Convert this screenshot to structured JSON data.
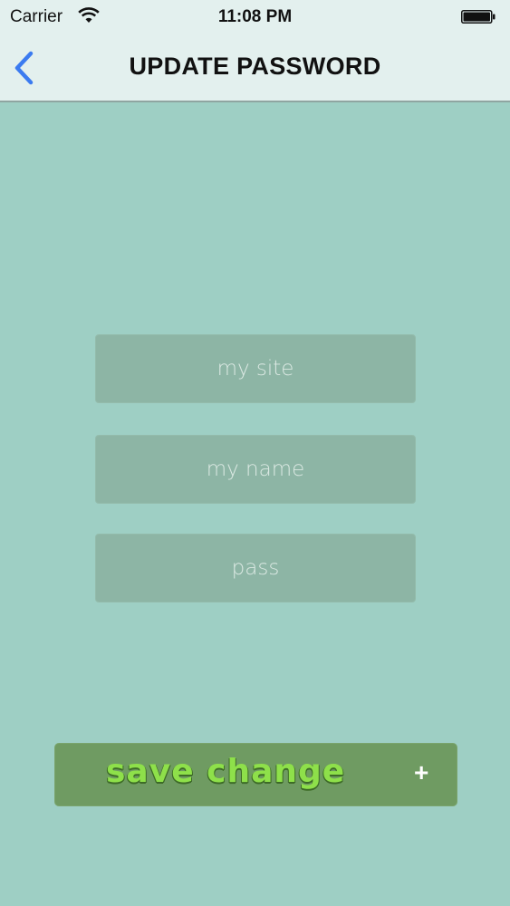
{
  "status_bar": {
    "carrier": "Carrier",
    "time": "11:08 PM",
    "wifi_icon": "wifi-icon",
    "battery_icon": "battery-icon"
  },
  "nav": {
    "title": "UPDATE PASSWORD",
    "back_icon": "chevron-left-icon",
    "accent_color": "#3b7bf0"
  },
  "form": {
    "site_placeholder": "my site",
    "name_placeholder": "my name",
    "pass_placeholder": "pass"
  },
  "save_button": {
    "label": "save change",
    "plus": "+"
  },
  "colors": {
    "background": "#9ecfc4",
    "field": "#8db5a5",
    "button": "#6f9b62",
    "button_text": "#8ee04a"
  }
}
